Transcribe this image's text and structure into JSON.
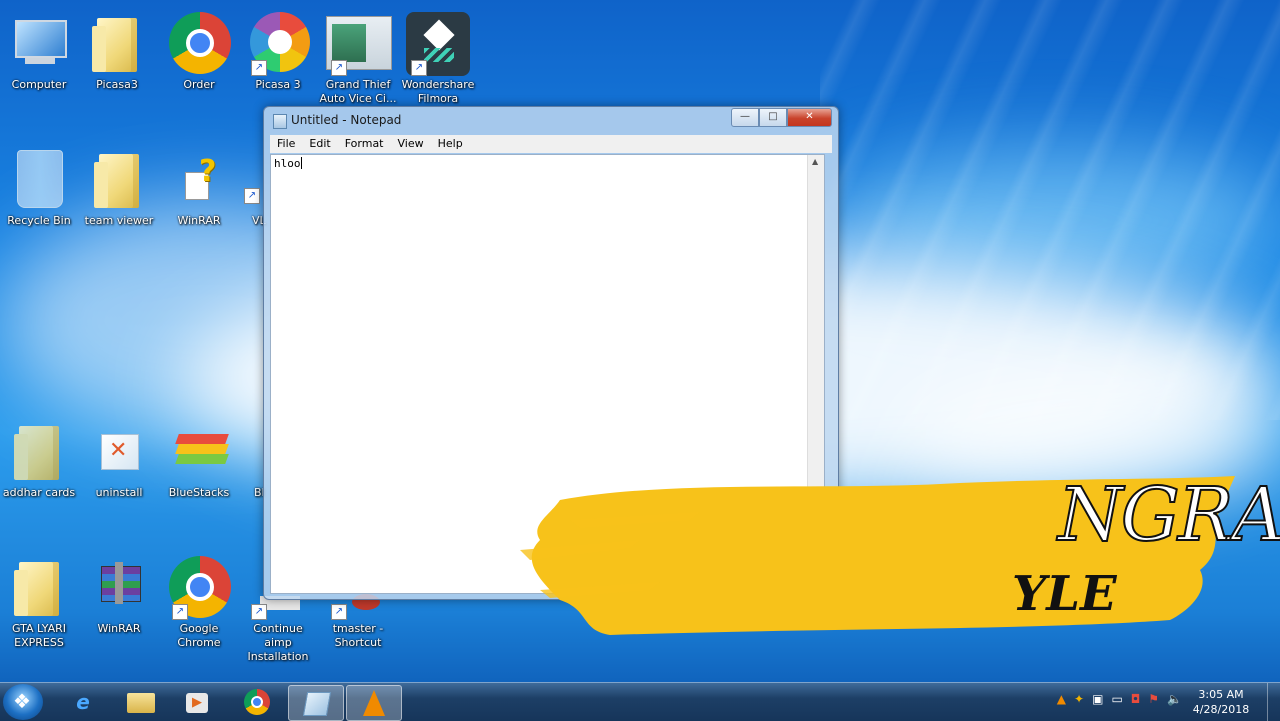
{
  "desktop": {
    "icons": [
      {
        "label": "Computer",
        "icon": "computer-icon",
        "shortcut": false
      },
      {
        "label": "Picasa3",
        "icon": "folder-icon",
        "shortcut": false
      },
      {
        "label": "Order",
        "icon": "chrome-icon",
        "shortcut": false
      },
      {
        "label": "Picasa 3",
        "icon": "picasa-icon",
        "shortcut": true
      },
      {
        "label": "Grand Thief Auto Vice Ci...",
        "icon": "gta-vice-city-icon",
        "shortcut": true
      },
      {
        "label": "Wondershare Filmora",
        "icon": "filmora-icon",
        "shortcut": true
      },
      {
        "label": "Recycle Bin",
        "icon": "recycle-bin-icon",
        "shortcut": false
      },
      {
        "label": "team viewer",
        "icon": "folder-icon",
        "shortcut": false
      },
      {
        "label": "WinRAR",
        "icon": "winrar-help-icon",
        "shortcut": false
      },
      {
        "label": "VL",
        "icon": "vlc-icon",
        "shortcut": true
      },
      {
        "label": "addhar cards",
        "icon": "folder-icon",
        "shortcut": false
      },
      {
        "label": "uninstall",
        "icon": "uninstall-icon",
        "shortcut": false
      },
      {
        "label": "BlueStacks",
        "icon": "bluestacks-icon",
        "shortcut": false
      },
      {
        "label": "Bl",
        "icon": "app-icon",
        "shortcut": true
      },
      {
        "label": "GTA LYARI EXPRESS",
        "icon": "folder-icon",
        "shortcut": false
      },
      {
        "label": "WinRAR",
        "icon": "winrar-icon",
        "shortcut": false
      },
      {
        "label": "Google Chrome",
        "icon": "chrome-icon",
        "shortcut": true
      },
      {
        "label": "Continue aimp Installation",
        "icon": "aimp-icon",
        "shortcut": true
      },
      {
        "label": "tmaster - Shortcut",
        "icon": "tmaster-icon",
        "shortcut": true
      }
    ]
  },
  "notepad": {
    "title": "Untitled - Notepad",
    "menu": [
      "File",
      "Edit",
      "Format",
      "View",
      "Help"
    ],
    "content": "hloo",
    "buttons": {
      "minimize": "—",
      "maximize": "□",
      "close": "✕"
    }
  },
  "overlay": {
    "line1": "NGRA",
    "line2": "YLE",
    "brush_color": "#f7c21a"
  },
  "taskbar": {
    "pinned": [
      "internet-explorer-icon",
      "file-explorer-icon",
      "media-player-icon",
      "chrome-icon",
      "notepad-icon",
      "vlc-icon"
    ],
    "clock_time": "3:05 AM",
    "clock_date": "4/28/2018"
  }
}
